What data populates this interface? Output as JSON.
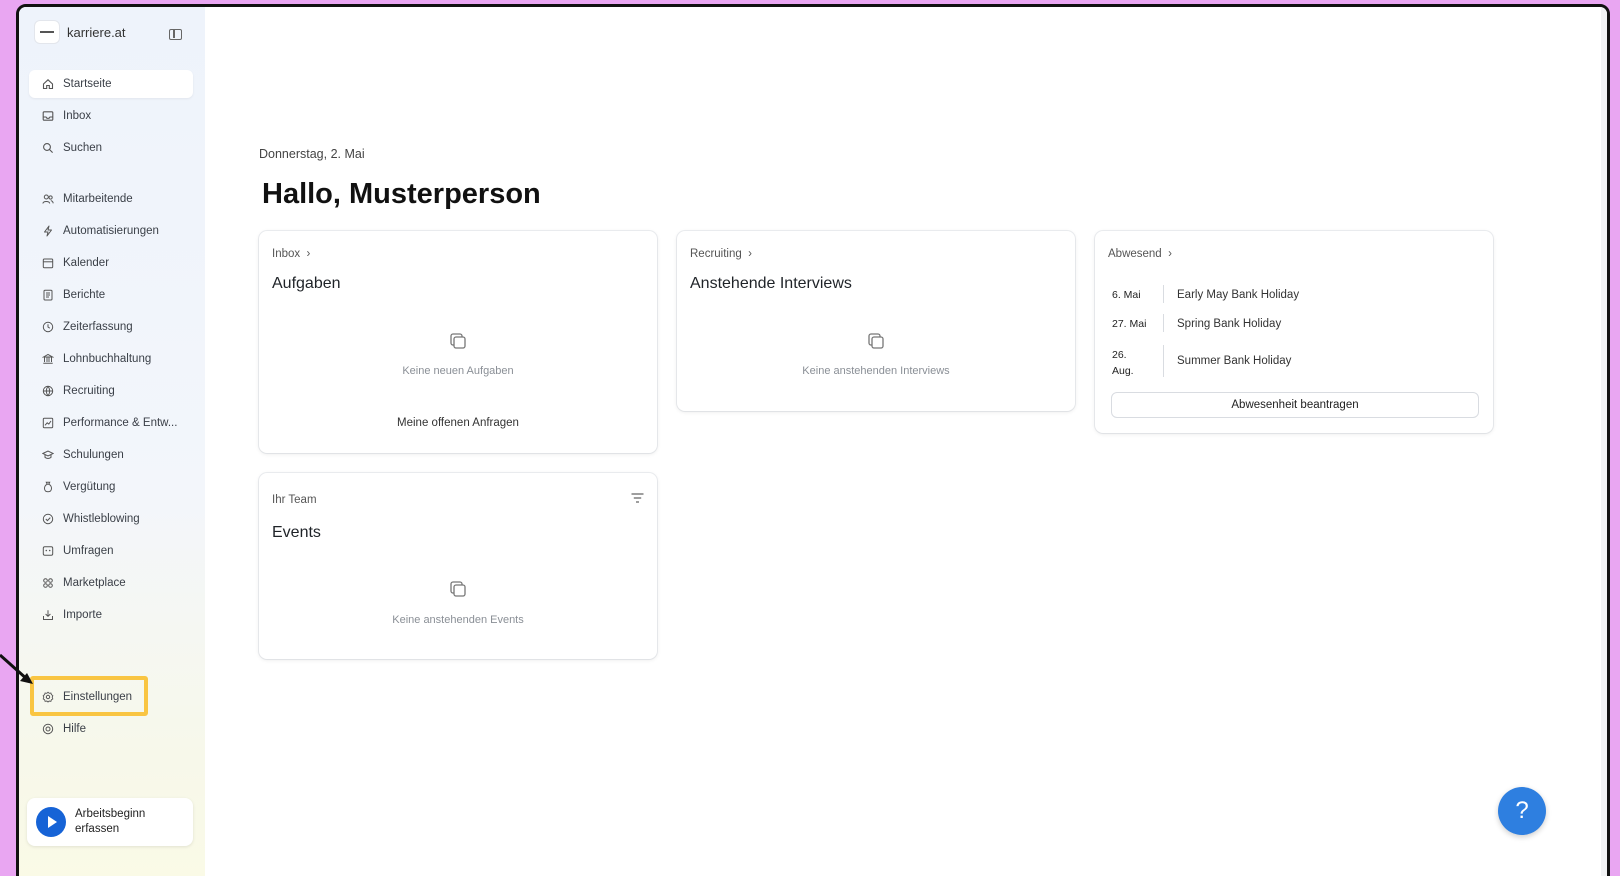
{
  "brand": {
    "name": "karriere.at"
  },
  "nav": {
    "top": [
      {
        "label": "Startseite",
        "icon": "home-icon",
        "active": true
      },
      {
        "label": "Inbox",
        "icon": "inbox-icon"
      },
      {
        "label": "Suchen",
        "icon": "search-icon"
      }
    ],
    "main": [
      {
        "label": "Mitarbeitende",
        "icon": "users-icon"
      },
      {
        "label": "Automatisierungen",
        "icon": "bolt-icon"
      },
      {
        "label": "Kalender",
        "icon": "calendar-icon"
      },
      {
        "label": "Berichte",
        "icon": "report-icon"
      },
      {
        "label": "Zeiterfassung",
        "icon": "clock-icon"
      },
      {
        "label": "Lohnbuchhaltung",
        "icon": "payroll-icon"
      },
      {
        "label": "Recruiting",
        "icon": "globe-icon"
      },
      {
        "label": "Performance & Entw...",
        "icon": "chart-icon"
      },
      {
        "label": "Schulungen",
        "icon": "graduation-icon"
      },
      {
        "label": "Vergütung",
        "icon": "money-bag-icon"
      },
      {
        "label": "Whistleblowing",
        "icon": "shield-icon"
      },
      {
        "label": "Umfragen",
        "icon": "survey-icon"
      },
      {
        "label": "Marketplace",
        "icon": "grid-icon"
      },
      {
        "label": "Importe",
        "icon": "import-icon"
      }
    ],
    "bottom": [
      {
        "label": "Einstellungen",
        "icon": "gear-icon"
      },
      {
        "label": "Hilfe",
        "icon": "help-circle-icon"
      }
    ]
  },
  "clock_in": {
    "label": "Arbeitsbeginn erfassen"
  },
  "header": {
    "date": "Donnerstag, 2. Mai",
    "greeting": "Hallo, Musterperson"
  },
  "cards": {
    "tasks": {
      "crumb": "Inbox",
      "title": "Aufgaben",
      "empty": "Keine neuen Aufgaben",
      "link": "Meine offenen Anfragen"
    },
    "interviews": {
      "crumb": "Recruiting",
      "title": "Anstehende Interviews",
      "empty": "Keine anstehenden Interviews"
    },
    "absent": {
      "crumb": "Abwesend",
      "rows": [
        {
          "date": "6. Mai",
          "name": "Early May Bank Holiday"
        },
        {
          "date": "27. Mai",
          "name": "Spring Bank Holiday"
        },
        {
          "date": "26. Aug.",
          "name": "Summer Bank Holiday"
        }
      ],
      "button": "Abwesenheit beantragen"
    },
    "events": {
      "crumb": "Ihr Team",
      "title": "Events",
      "empty": "Keine anstehenden Events"
    }
  },
  "help_button": {
    "label": "?"
  },
  "colors": {
    "accent": "#1663d6",
    "highlight": "#f9c542",
    "help": "#2e7fe0",
    "backdrop": "#e9a6f2"
  }
}
